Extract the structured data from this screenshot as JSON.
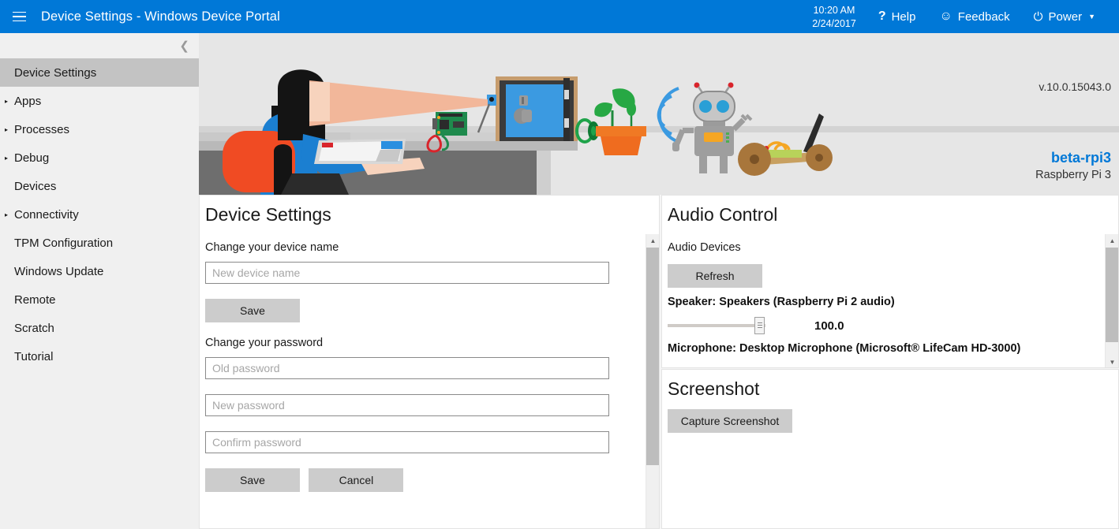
{
  "header": {
    "menu_icon": "hamburger-icon",
    "title": "Device Settings - Windows Device Portal",
    "time": "10:20 AM",
    "date": "2/24/2017",
    "help_label": "Help",
    "help_icon": "question-mark-icon",
    "feedback_label": "Feedback",
    "feedback_icon": "smiley-face-icon",
    "power_label": "Power",
    "power_icon": "power-icon",
    "power_caret": "▼",
    "accent_color": "#0078d7"
  },
  "sidebar": {
    "collapse_icon": "chevron-left-icon",
    "items": [
      {
        "label": "Device Settings",
        "expandable": false,
        "selected": true
      },
      {
        "label": "Apps",
        "expandable": true,
        "selected": false
      },
      {
        "label": "Processes",
        "expandable": true,
        "selected": false
      },
      {
        "label": "Debug",
        "expandable": true,
        "selected": false
      },
      {
        "label": "Devices",
        "expandable": false,
        "selected": false
      },
      {
        "label": "Connectivity",
        "expandable": true,
        "selected": false
      },
      {
        "label": "TPM Configuration",
        "expandable": false,
        "selected": false
      },
      {
        "label": "Windows Update",
        "expandable": false,
        "selected": false
      },
      {
        "label": "Remote",
        "expandable": false,
        "selected": false
      },
      {
        "label": "Scratch",
        "expandable": false,
        "selected": false
      },
      {
        "label": "Tutorial",
        "expandable": false,
        "selected": false
      }
    ],
    "expand_arrow": "▸",
    "selected_bg": "#c3c3c3"
  },
  "banner": {
    "illustration": "iot-workbench-illustration",
    "version": "v.10.0.15043.0",
    "device_name": "beta-rpi3",
    "device_model": "Raspberry Pi 3",
    "device_name_color": "#0078d7"
  },
  "device_settings": {
    "title": "Device Settings",
    "device_name_label": "Change your device name",
    "device_name_value": "",
    "device_name_placeholder": "New device name",
    "device_name_save_label": "Save",
    "password_label": "Change your password",
    "old_password_value": "",
    "old_password_placeholder": "Old password",
    "new_password_value": "",
    "new_password_placeholder": "New password",
    "confirm_password_value": "",
    "confirm_password_placeholder": "Confirm password",
    "password_save_label": "Save",
    "password_cancel_label": "Cancel"
  },
  "audio_control": {
    "title": "Audio Control",
    "devices_label": "Audio Devices",
    "refresh_label": "Refresh",
    "speaker_line": "Speaker: Speakers (Raspberry Pi 2 audio)",
    "speaker_volume": "100.0",
    "microphone_line": "Microphone: Desktop Microphone (Microsoft® LifeCam HD-3000)"
  },
  "screenshot": {
    "title": "Screenshot",
    "capture_label": "Capture Screenshot"
  },
  "scrollbars": {
    "up_arrow": "▲",
    "down_arrow": "▼"
  }
}
